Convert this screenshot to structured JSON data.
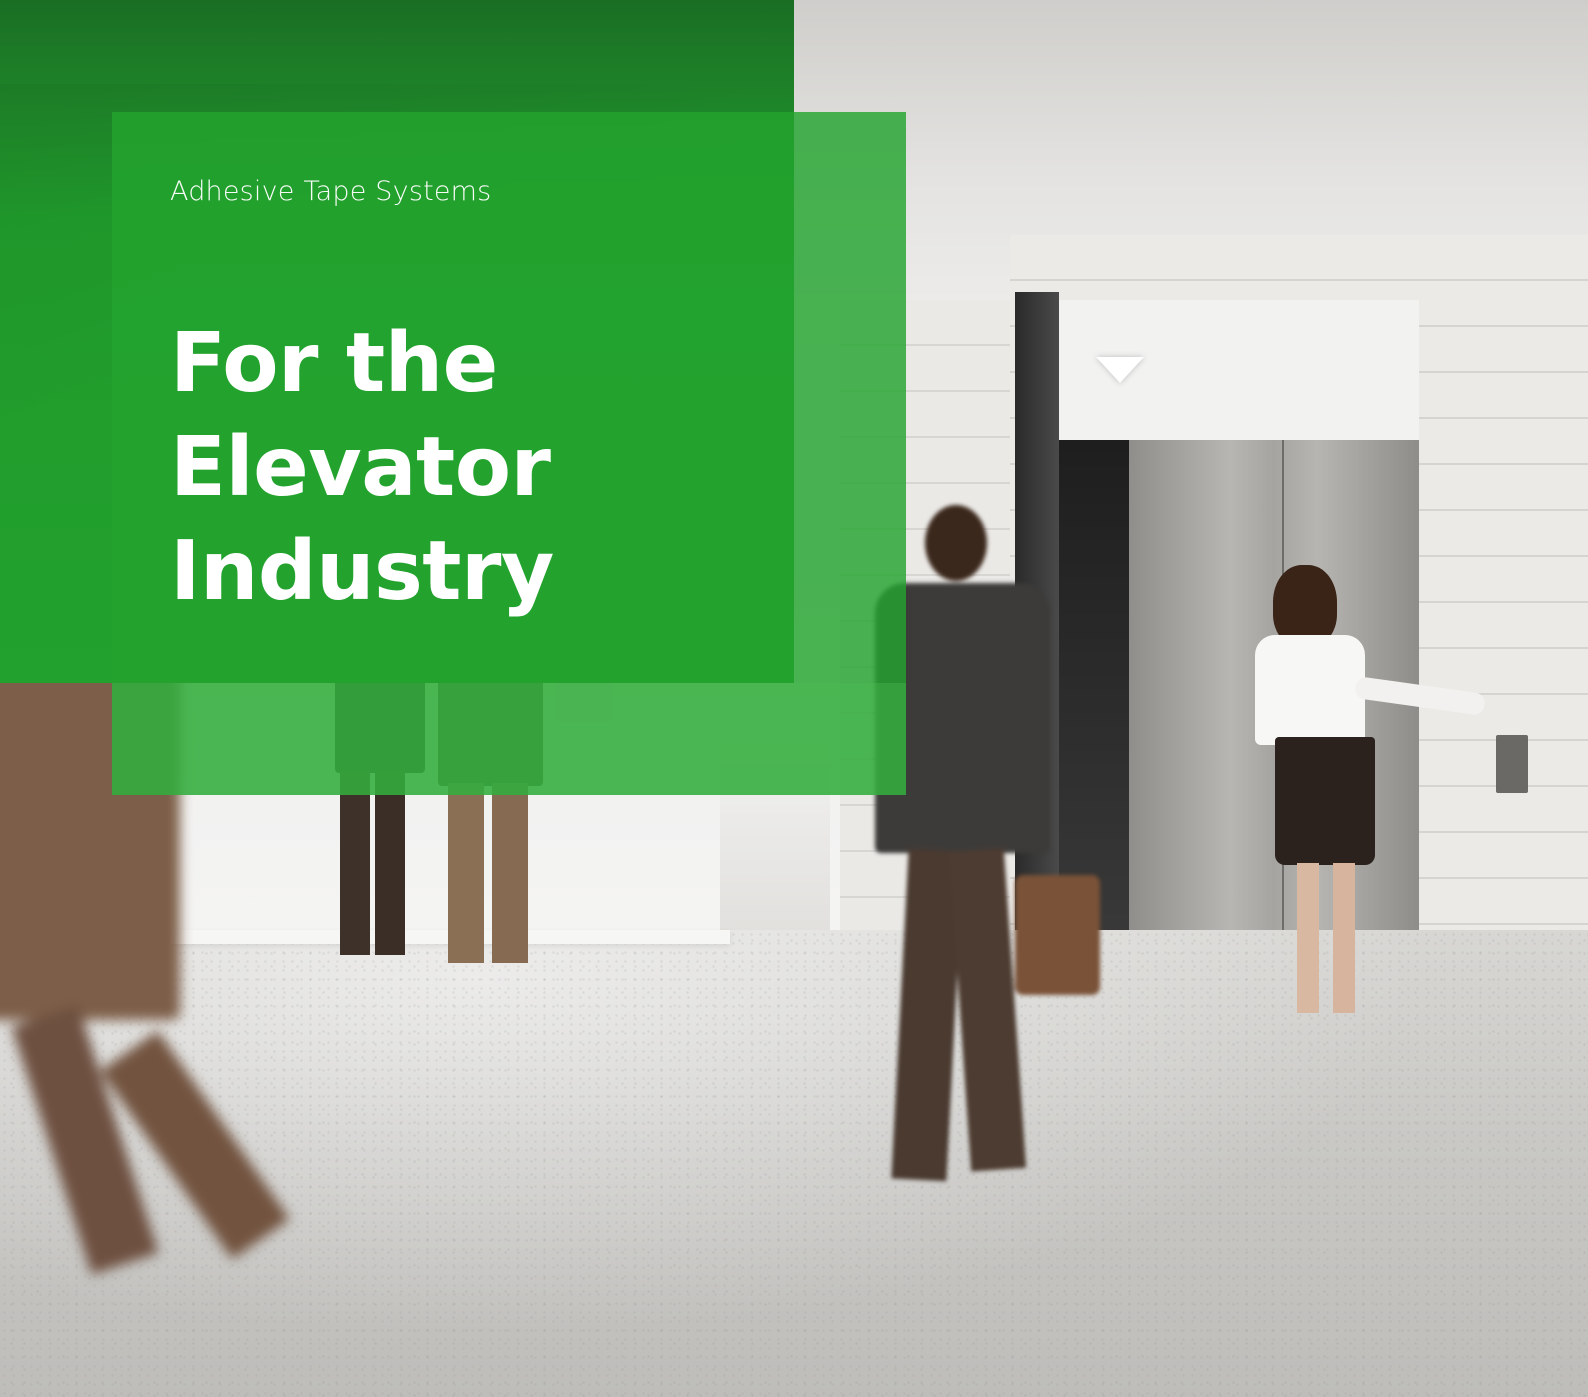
{
  "cover": {
    "kicker": "Adhesive Tape Systems",
    "headline_line1": "For the Elevator",
    "headline_line2": "Industry"
  },
  "colors": {
    "brand_green_dark": "#1f8a2a",
    "brand_green": "#23a42e",
    "text": "#ffffff"
  }
}
